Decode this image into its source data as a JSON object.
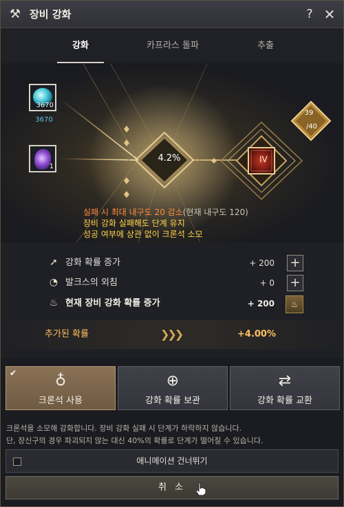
{
  "window": {
    "title": "장비 강화",
    "title_icon": "hammer-wrench-icon",
    "help_label": "?",
    "close_label": "✕"
  },
  "tabs": [
    {
      "label": "강화",
      "active": true
    },
    {
      "label": "카프라스 돌파",
      "active": false
    },
    {
      "label": "추출",
      "active": false
    }
  ],
  "materials": {
    "crystal": {
      "icon": "blue-crystal-icon",
      "count": "3670",
      "owned": "3670"
    },
    "stone": {
      "icon": "purple-stone-icon",
      "count": "1"
    }
  },
  "enhance": {
    "success_rate": "4.2%",
    "stage": "IV",
    "counter_current": "39",
    "counter_max": "/40"
  },
  "warnings": {
    "line1": "실패 시 최대 내구도 20 감소",
    "line1_suffix": "(현재 내구도 120)",
    "line2": "장비 강화 실패해도 단계 유지",
    "line3": "성공 여부에 상관 없이 크론석 소모"
  },
  "rates": [
    {
      "icon": "arrow-up-icon",
      "label": "강화 확률 증가",
      "value": "+ 200",
      "button": "+"
    },
    {
      "icon": "valks-cry-icon",
      "label": "발크스의 외침",
      "value": "+ 0",
      "button": "+"
    },
    {
      "icon": "flame-icon",
      "label": "현재 장비 강화 확률 증가",
      "value": "+ 200"
    }
  ],
  "added_rate": {
    "label": "추가된 확률",
    "chevrons": "❯❯❯",
    "value": "+4.00%"
  },
  "actions": [
    {
      "label": "크론석 사용",
      "icon": "cron-stone-icon",
      "selected": true
    },
    {
      "label": "강화 확률 보관",
      "icon": "download-circle-icon",
      "selected": false
    },
    {
      "label": "강화 확률 교환",
      "icon": "swap-arrows-icon",
      "selected": false
    }
  ],
  "description": {
    "line1": "크론석을 소모해 강화합니다. 장비 강화 실패 시 단계가 하락하지 않습니다.",
    "line2": "단, 장신구의 경우 파괴되지 않는 대신 40%의 확률로 단계가 떨어질 수 있습니다."
  },
  "skip_animation": {
    "label": "애니메이션 건너뛰기",
    "checked": false
  },
  "cancel_label": "취 소",
  "colors": {
    "accent_gold": "#ffc060",
    "warning_orange": "#ff8a3d",
    "warning_yellow": "#ffd34a",
    "crystal_blue": "#5ec9e8"
  }
}
